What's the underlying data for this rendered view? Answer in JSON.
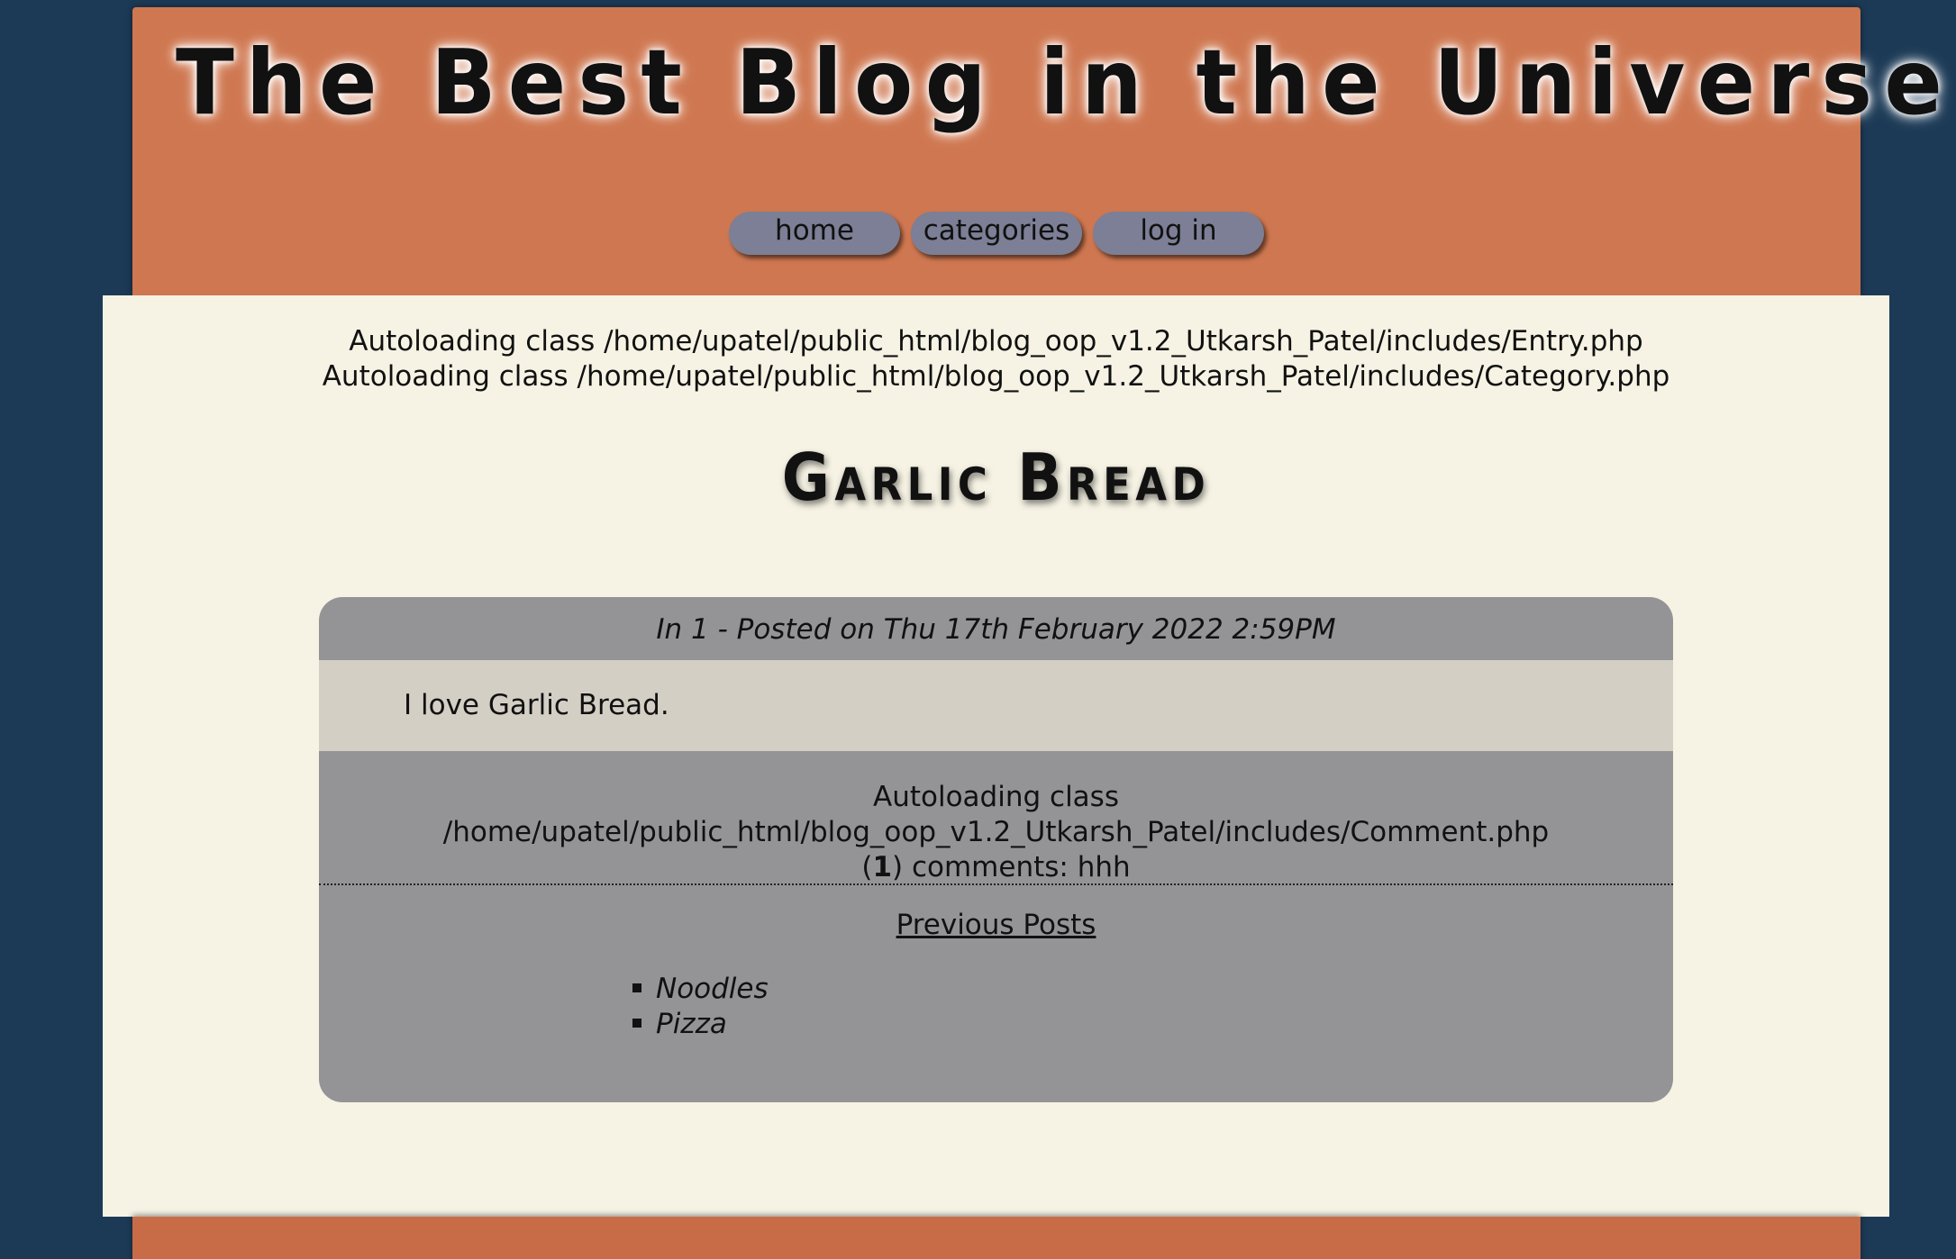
{
  "site": {
    "title": "The Best Blog in the Universe"
  },
  "nav": {
    "items": [
      {
        "label": "home"
      },
      {
        "label": "categories"
      },
      {
        "label": "log in"
      }
    ]
  },
  "debug": {
    "autoload_entry": "Autoloading class /home/upatel/public_html/blog_oop_v1.2_Utkarsh_Patel/includes/Entry.php",
    "autoload_category": "Autoloading class /home/upatel/public_html/blog_oop_v1.2_Utkarsh_Patel/includes/Category.php",
    "autoload_comment": "Autoloading class /home/upatel/public_html/blog_oop_v1.2_Utkarsh_Patel/includes/Comment.php"
  },
  "entry": {
    "title": "Garlic Bread",
    "meta": "In 1 - Posted on Thu 17th February 2022 2:59PM",
    "body": "I love Garlic Bread.",
    "comments": {
      "count_open": "(",
      "count": "1",
      "count_close": ")",
      "label": " comments: hhh"
    }
  },
  "previous_posts": {
    "heading": "Previous Posts",
    "items": [
      "Noodles",
      "Pizza"
    ]
  }
}
